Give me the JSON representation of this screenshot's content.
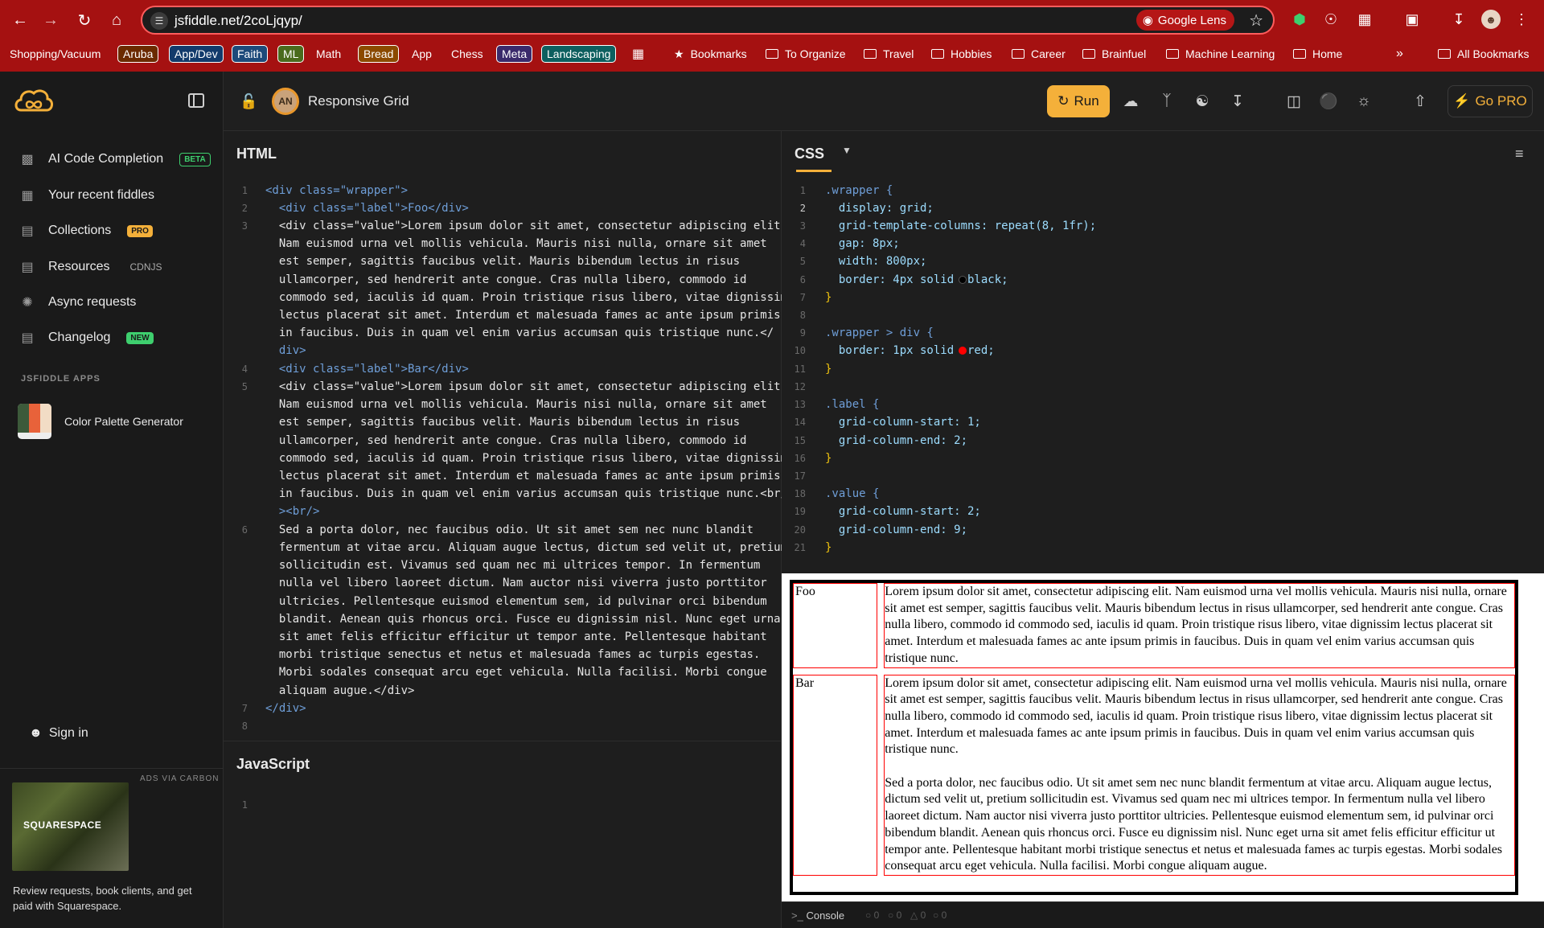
{
  "browser": {
    "url": "jsfiddle.net/2coLjqyp/",
    "lens_label": "Google Lens",
    "bookmarks": {
      "shopping": "Shopping/Vacuum",
      "aruba": "Aruba",
      "appdev": "App/Dev",
      "faith": "Faith",
      "ml": "ML",
      "math": "Math",
      "bread": "Bread",
      "app": "App",
      "chess": "Chess",
      "meta": "Meta",
      "landscaping": "Landscaping",
      "bookmarks": "Bookmarks",
      "to_organize": "To Organize",
      "travel": "Travel",
      "hobbies": "Hobbies",
      "career": "Career",
      "brainfuel": "Brainfuel",
      "machine_learning": "Machine Learning",
      "home": "Home",
      "all_bookmarks": "All Bookmarks"
    }
  },
  "header": {
    "avatar_initials": "AN",
    "fiddle_title": "Responsive Grid",
    "run_label": "Run",
    "gopro_label": "Go PRO"
  },
  "sidebar": {
    "ai_code_completion": "AI Code Completion",
    "ai_badge": "BETA",
    "recent_fiddles": "Your recent fiddles",
    "collections": "Collections",
    "collections_badge": "PRO",
    "resources": "Resources",
    "resources_badge": "CDNJS",
    "async_requests": "Async requests",
    "changelog": "Changelog",
    "changelog_badge": "NEW",
    "apps_heading": "JSFIDDLE APPS",
    "palette_app": "Color Palette Generator",
    "sign_in": "Sign in",
    "ads_label": "ADS VIA CARBON",
    "ad_brand": "SQUARESPACE",
    "ad_text": "Review requests, book clients, and get paid with Squarespace."
  },
  "panels": {
    "html_title": "HTML",
    "css_title": "CSS",
    "js_title": "JavaScript"
  },
  "html_code": {
    "l1": "<div class=\"wrapper\">",
    "l2": "  <div class=\"label\">Foo</div>",
    "l3a": "  <div class=\"value\">Lorem ipsum dolor sit amet, consectetur adipiscing elit.",
    "l3b": "  Nam euismod urna vel mollis vehicula. Mauris nisi nulla, ornare sit amet",
    "l3c": "  est semper, sagittis faucibus velit. Mauris bibendum lectus in risus",
    "l3d": "  ullamcorper, sed hendrerit ante congue. Cras nulla libero, commodo id",
    "l3e": "  commodo sed, iaculis id quam. Proin tristique risus libero, vitae dignissim",
    "l3f": "  lectus placerat sit amet. Interdum et malesuada fames ac ante ipsum primis",
    "l3g": "  in faucibus. Duis in quam vel enim varius accumsan quis tristique nunc.</",
    "l3h": "  div>",
    "l4": "  <div class=\"label\">Bar</div>",
    "l5a": "  <div class=\"value\">Lorem ipsum dolor sit amet, consectetur adipiscing elit.",
    "l5b": "  Nam euismod urna vel mollis vehicula. Mauris nisi nulla, ornare sit amet",
    "l5c": "  est semper, sagittis faucibus velit. Mauris bibendum lectus in risus",
    "l5d": "  ullamcorper, sed hendrerit ante congue. Cras nulla libero, commodo id",
    "l5e": "  commodo sed, iaculis id quam. Proin tristique risus libero, vitae dignissim",
    "l5f": "  lectus placerat sit amet. Interdum et malesuada fames ac ante ipsum primis",
    "l5g": "  in faucibus. Duis in quam vel enim varius accumsan quis tristique nunc.<br/",
    "l5h": "  ><br/>",
    "l6a": "  Sed a porta dolor, nec faucibus odio. Ut sit amet sem nec nunc blandit",
    "l6b": "  fermentum at vitae arcu. Aliquam augue lectus, dictum sed velit ut, pretium",
    "l6c": "  sollicitudin est. Vivamus sed quam nec mi ultrices tempor. In fermentum",
    "l6d": "  nulla vel libero laoreet dictum. Nam auctor nisi viverra justo porttitor",
    "l6e": "  ultricies. Pellentesque euismod elementum sem, id pulvinar orci bibendum",
    "l6f": "  blandit. Aenean quis rhoncus orci. Fusce eu dignissim nisl. Nunc eget urna",
    "l6g": "  sit amet felis efficitur efficitur ut tempor ante. Pellentesque habitant",
    "l6h": "  morbi tristique senectus et netus et malesuada fames ac turpis egestas.",
    "l6i": "  Morbi sodales consequat arcu eget vehicula. Nulla facilisi. Morbi congue",
    "l6j": "  aliquam augue.</div>",
    "l7": "</div>"
  },
  "css_code": {
    "l1": ".wrapper {",
    "l2": "  display: grid;",
    "l3": "  grid-template-columns: repeat(8, 1fr);",
    "l4": "  gap: 8px;",
    "l5": "  width: 800px;",
    "l6": "  border: 4px solid  black;",
    "l7": "}",
    "l9": ".wrapper > div {",
    "l10": "  border: 1px solid  red;",
    "l11": "}",
    "l13": ".label {",
    "l14": "  grid-column-start: 1;",
    "l15": "  grid-column-end: 2;",
    "l16": "}",
    "l18": ".value {",
    "l19": "  grid-column-start: 2;",
    "l20": "  grid-column-end: 9;",
    "l21": "}"
  },
  "result": {
    "foo_label": "Foo",
    "foo_value": "Lorem ipsum dolor sit amet, consectetur adipiscing elit. Nam euismod urna vel mollis vehicula. Mauris nisi nulla, ornare sit amet est semper, sagittis faucibus velit. Mauris bibendum lectus in risus ullamcorper, sed hendrerit ante congue. Cras nulla libero, commodo id commodo sed, iaculis id quam. Proin tristique risus libero, vitae dignissim lectus placerat sit amet. Interdum et malesuada fames ac ante ipsum primis in faucibus. Duis in quam vel enim varius accumsan quis tristique nunc.",
    "bar_label": "Bar",
    "bar_value_p1": "Lorem ipsum dolor sit amet, consectetur adipiscing elit. Nam euismod urna vel mollis vehicula. Mauris nisi nulla, ornare sit amet est semper, sagittis faucibus velit. Mauris bibendum lectus in risus ullamcorper, sed hendrerit ante congue. Cras nulla libero, commodo id commodo sed, iaculis id quam. Proin tristique risus libero, vitae dignissim lectus placerat sit amet. Interdum et malesuada fames ac ante ipsum primis in faucibus. Duis in quam vel enim varius accumsan quis tristique nunc.",
    "bar_value_p2": "Sed a porta dolor, nec faucibus odio. Ut sit amet sem nec nunc blandit fermentum at vitae arcu. Aliquam augue lectus, dictum sed velit ut, pretium sollicitudin est. Vivamus sed quam nec mi ultrices tempor. In fermentum nulla vel libero laoreet dictum. Nam auctor nisi viverra justo porttitor ultricies. Pellentesque euismod elementum sem, id pulvinar orci bibendum blandit. Aenean quis rhoncus orci. Fusce eu dignissim nisl. Nunc eget urna sit amet felis efficitur efficitur ut tempor ante. Pellentesque habitant morbi tristique senectus et netus et malesuada fames ac turpis egestas. Morbi sodales consequat arcu eget vehicula. Nulla facilisi. Morbi congue aliquam augue."
  },
  "console": {
    "label": "Console",
    "c1": "0",
    "c2": "0",
    "c3": "0",
    "c4": "0"
  },
  "colors": {
    "chrome_red": "#a51111",
    "accent": "#f4b03a",
    "result_border": "#000000",
    "cell_border": "#ff0000"
  }
}
